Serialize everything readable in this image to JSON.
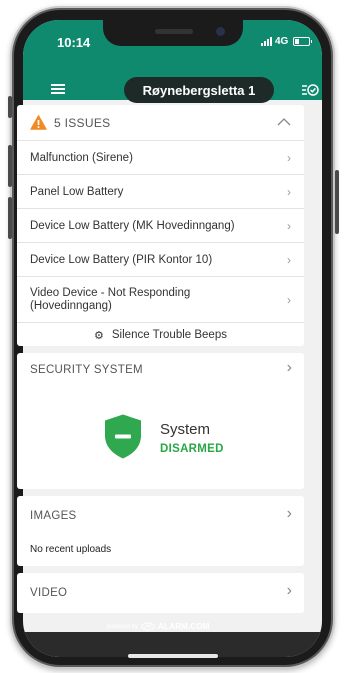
{
  "status_bar": {
    "time": "10:14",
    "network": "4G"
  },
  "header": {
    "location": "Røynebergsletta 1"
  },
  "issues": {
    "title": "5 ISSUES",
    "items": [
      {
        "label": "Malfunction (Sirene)"
      },
      {
        "label": "Panel Low Battery"
      },
      {
        "label": "Device Low Battery (MK Hovedinngang)"
      },
      {
        "label": "Device Low Battery (PIR Kontor 10)"
      },
      {
        "label": "Video Device - Not Responding (Hovedinngang)"
      }
    ],
    "silence_label": "Silence Trouble Beeps"
  },
  "security": {
    "title": "SECURITY SYSTEM",
    "system_label": "System",
    "state": "DISARMED",
    "state_color": "#28a745"
  },
  "images": {
    "title": "IMAGES",
    "empty_text": "No recent uploads"
  },
  "video": {
    "title": "VIDEO"
  },
  "footer": {
    "powered_by": "powered by",
    "brand": "ALARM.COM"
  },
  "colors": {
    "header": "#0f8a6f",
    "warning": "#f08a24",
    "shield": "#2fa84f"
  }
}
